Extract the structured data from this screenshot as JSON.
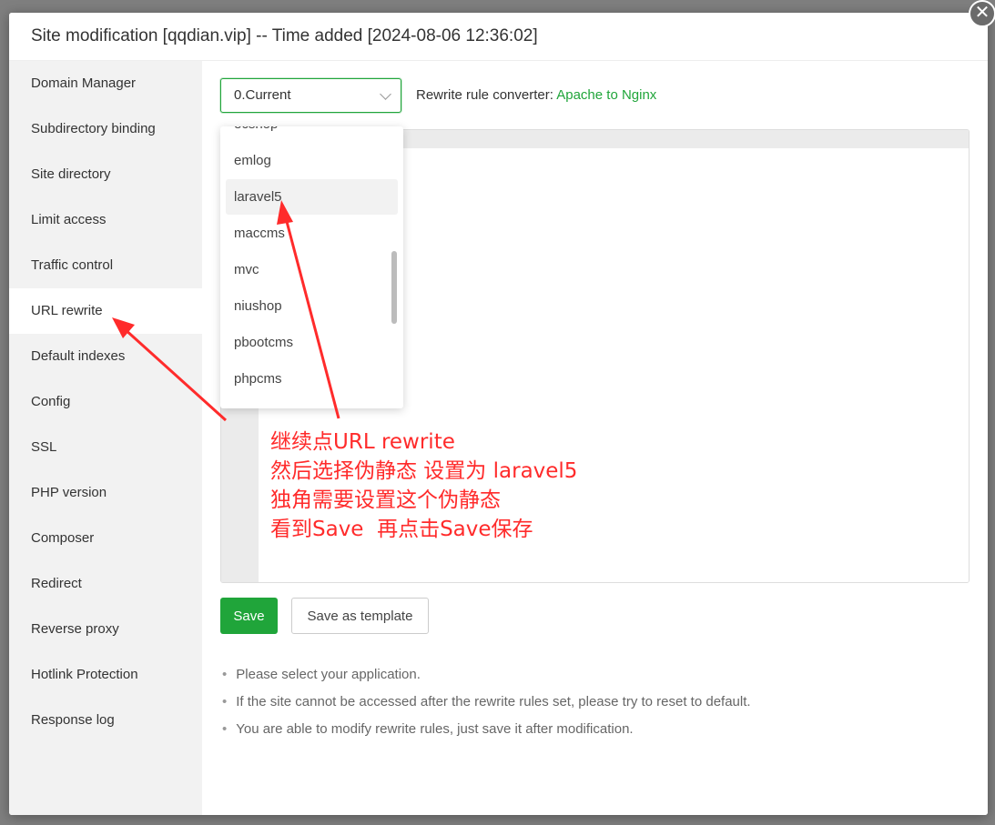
{
  "modal": {
    "title": "Site modification [qqdian.vip] -- Time added [2024-08-06 12:36:02]",
    "close_icon": "close-icon"
  },
  "sidebar": {
    "items": [
      {
        "label": "Domain Manager"
      },
      {
        "label": "Subdirectory binding"
      },
      {
        "label": "Site directory"
      },
      {
        "label": "Limit access"
      },
      {
        "label": "Traffic control"
      },
      {
        "label": "URL rewrite",
        "active": true
      },
      {
        "label": "Default indexes"
      },
      {
        "label": "Config"
      },
      {
        "label": "SSL"
      },
      {
        "label": "PHP version"
      },
      {
        "label": "Composer"
      },
      {
        "label": "Redirect"
      },
      {
        "label": "Reverse proxy"
      },
      {
        "label": "Hotlink Protection"
      },
      {
        "label": "Response log"
      }
    ]
  },
  "rewrite": {
    "selected": "0.Current",
    "converter_label": "Rewrite rule converter:",
    "converter_link": "Apache to Nginx",
    "options": [
      "ecshop",
      "emlog",
      "laravel5",
      "maccms",
      "mvc",
      "niushop",
      "pbootcms",
      "phpcms"
    ],
    "hovered_option": "laravel5"
  },
  "annotation": {
    "lines": [
      "继续点URL rewrite",
      "然后选择伪静态 设置为 laravel5",
      "独角需要设置这个伪静态",
      "看到Save  再点击Save保存"
    ],
    "color": "#ff2b2b"
  },
  "buttons": {
    "save": "Save",
    "save_template": "Save as template"
  },
  "tips": [
    "Please select your application.",
    "If the site cannot be accessed after the rewrite rules set, please try to reset to default.",
    "You are able to modify rewrite rules, just save it after modification."
  ],
  "colors": {
    "accent": "#20a53a",
    "sidebar_bg": "#f2f2f2"
  }
}
